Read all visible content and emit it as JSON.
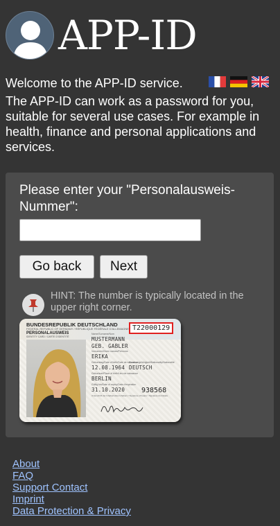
{
  "header": {
    "title": "APP-ID",
    "avatar_icon": "user-silhouette-icon"
  },
  "welcome": {
    "text": "Welcome to the APP-ID service.",
    "flags": [
      "france-flag-icon",
      "germany-flag-icon",
      "uk-flag-icon"
    ],
    "intro": "The APP-ID can work as a password for you, suitable for several use cases. For example in health, finance and personal applications and services."
  },
  "form": {
    "prompt": "Please enter your \"Personalausweis-Nummer\":",
    "input_value": "",
    "back_label": "Go back",
    "next_label": "Next",
    "hint": "HINT: The number is typically located in the upper right corner.",
    "hint_icon": "pushpin-icon"
  },
  "id_card": {
    "country": "BUNDESREPUBLIK DEUTSCHLAND",
    "country_sub": "FEDERAL REPUBLIC OF GERMANY / RÉPUBLIQUE FÉDÉRALE D'ALLEMAGNE",
    "doc_type": "PERSONALAUSWEIS",
    "doc_type_sub": "IDENTITY CARD / CARTE D'IDENTITÉ",
    "doc_number": "T22000129",
    "lbl_name": "Name/Surname/Nom",
    "surname": "MUSTERMANN",
    "birth_name": "GEB. GABLER",
    "lbl_given": "Vornamen/Given names/Prénoms",
    "given_names": "ERIKA",
    "lbl_dob": "Geburtstag/Date of birth/Date de naissance",
    "dob": "12.08.1964",
    "lbl_nat": "Staatsangehörigkeit/Nationality/Nationalité",
    "nationality": "DEUTSCH",
    "lbl_pob": "Geburtsort/Place of birth/Lieu de naissance",
    "place_of_birth": "BERLIN",
    "lbl_expiry": "Gültig bis/Date of expiry/Date d'expiration",
    "expiry": "31.10.2020",
    "can": "938568",
    "lbl_signature": "Unterschrift der Inhaberin/des Inhabers / Signature of bearer / Signature du titulaire"
  },
  "footer": {
    "links": [
      "About",
      "FAQ",
      "Support Contact",
      "Imprint",
      "Data Protection & Privacy"
    ]
  }
}
